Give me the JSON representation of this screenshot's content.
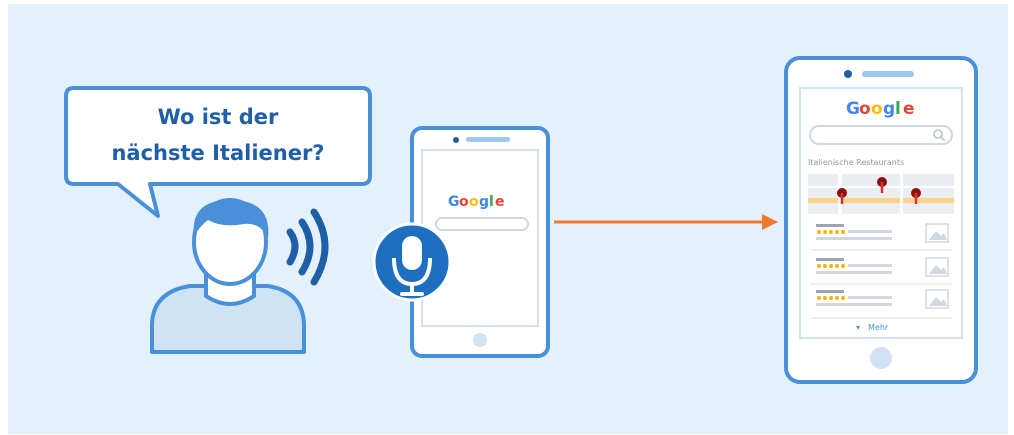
{
  "speech_bubble": {
    "line1": "Wo ist der",
    "line2": "nächste Italiener?"
  },
  "left_phone": {
    "logo": [
      "G",
      "o",
      "o",
      "g",
      "l",
      "e"
    ]
  },
  "right_phone": {
    "logo": [
      "G",
      "o",
      "o",
      "g",
      "l",
      "e"
    ],
    "results_heading": "Italienische Restaurants",
    "more_link": "Mehr"
  },
  "colors": {
    "background": "#e3f1fc",
    "outline": "#4a90d9",
    "person": "#cfe3f5",
    "mic_badge": "#1f6fc0",
    "arrow": "#f07a2a",
    "stars": "#f4b400",
    "pin": "#d93025",
    "google_blue": "#4285f4",
    "google_red": "#ea4335",
    "google_yellow": "#fbbc05",
    "google_green": "#34a853"
  },
  "icons": [
    "person-icon",
    "sound-waves-icon",
    "microphone-icon",
    "search-icon",
    "map-pin-icon",
    "star-icon",
    "thumbnail-icon",
    "arrow-right-icon"
  ]
}
